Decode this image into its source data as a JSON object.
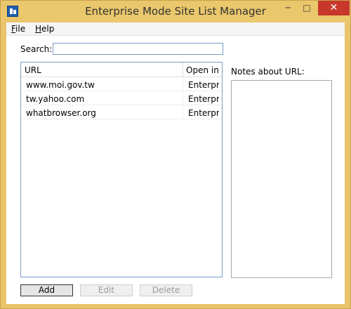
{
  "window": {
    "title": "Enterprise Mode Site List Manager",
    "icon": "app-icon",
    "minimize": "─",
    "maximize": "□",
    "close": "✕"
  },
  "menu": {
    "file": {
      "accel": "F",
      "rest": "ile"
    },
    "help": {
      "accel": "H",
      "rest": "elp"
    }
  },
  "search": {
    "label": "Search:",
    "value": ""
  },
  "list": {
    "columns": [
      "URL",
      "Open in"
    ],
    "rows": [
      {
        "url": "www.moi.gov.tw",
        "open_in": "Enterprise"
      },
      {
        "url": "tw.yahoo.com",
        "open_in": "Enterprise"
      },
      {
        "url": "whatbrowser.org",
        "open_in": "Enterprise"
      }
    ]
  },
  "notes": {
    "label": "Notes about URL:",
    "value": ""
  },
  "buttons": {
    "add": "Add",
    "edit": "Edit",
    "delete": "Delete"
  },
  "colors": {
    "title_bar": "#eac76c",
    "close_button": "#c7382b",
    "input_border": "#7a9cc8"
  }
}
